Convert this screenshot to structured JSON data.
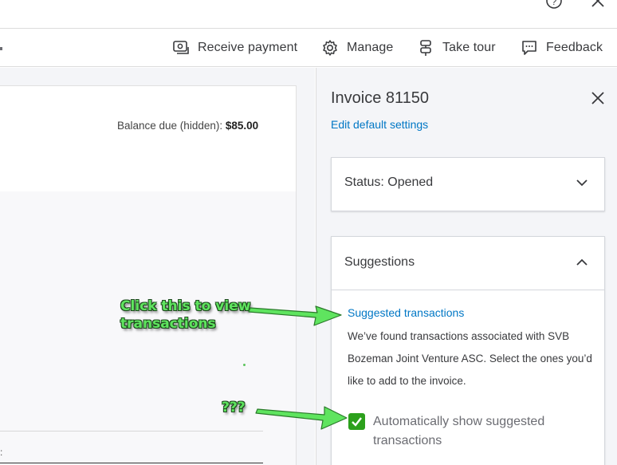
{
  "toolbar": {
    "receive_payment": "Receive payment",
    "manage": "Manage",
    "take_tour": "Take tour",
    "feedback": "Feedback"
  },
  "invoice": {
    "balance_label": "Balance due (hidden): ",
    "balance_value": "$85.00"
  },
  "panel": {
    "title": "Invoice 81150",
    "edit_link": "Edit default settings",
    "status_label": "Status: Opened",
    "suggestions": {
      "title": "Suggestions",
      "link": "Suggested transactions",
      "description": "We’ve found transactions associated with SVB Bozeman Joint Venture ASC. Select the ones you’d like to add to the invoice.",
      "checkbox_label": "Automatically show suggested transactions",
      "checkbox_checked": true
    }
  },
  "annotations": {
    "click_note_line1": "Click this to view",
    "click_note_line2": "transactions",
    "question_note": "???"
  },
  "left_panel": {
    "colon": ":"
  },
  "colors": {
    "accent_link": "#0077c5",
    "checkbox_green": "#2ca01c",
    "annotation_green": "#5fe45f"
  }
}
